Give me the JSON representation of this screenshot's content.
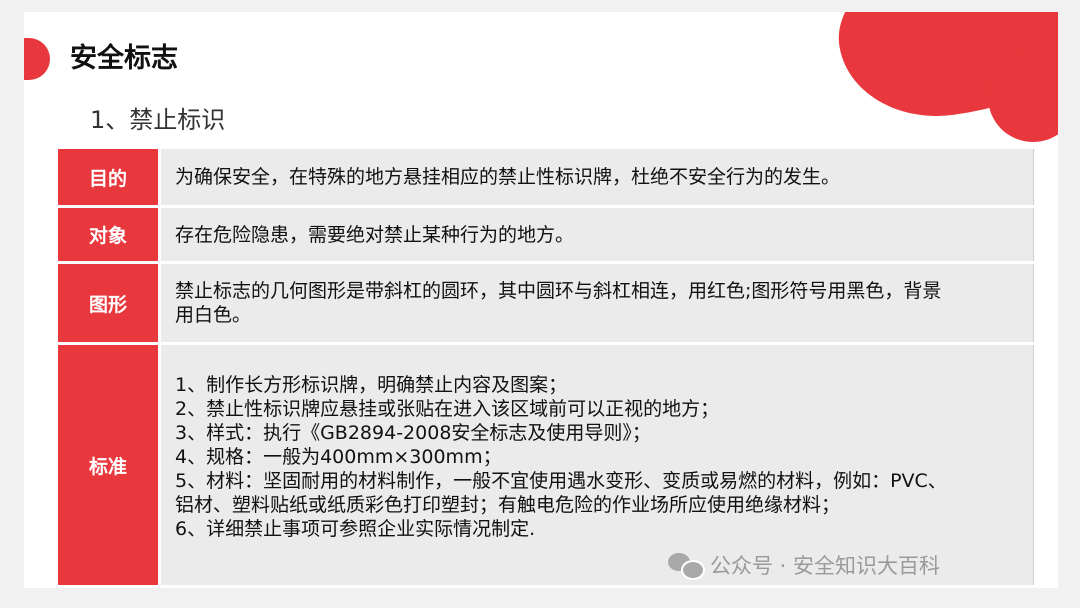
{
  "page": {
    "title": "安全标志",
    "subtitle": "1、禁止标识"
  },
  "table": {
    "rows": [
      {
        "label": "目的",
        "lines": [
          "为确保安全，在特殊的地方悬挂相应的禁止性标识牌，杜绝不安全行为的发生。"
        ]
      },
      {
        "label": "对象",
        "lines": [
          "存在危险隐患，需要绝对禁止某种行为的地方。"
        ]
      },
      {
        "label": "图形",
        "lines": [
          "禁止标志的几何图形是带斜杠的圆环，其中圆环与斜杠相连，用红色;图形符号用黑色，背景",
          "用白色。"
        ]
      },
      {
        "label": "标准",
        "lines": [
          "1、制作长方形标识牌，明确禁止内容及图案；",
          "2、禁止性标识牌应悬挂或张贴在进入该区域前可以正视的地方；",
          "3、样式：执行《GB2894-2008安全标志及使用导则》；",
          "4、规格：一般为400mm×300mm；",
          "5、材料：坚固耐用的材料制作，一般不宜使用遇水变形、变质或易燃的材料，例如：PVC、",
          "铝材、塑料贴纸或纸质彩色打印塑封；有触电危险的作业场所应使用绝缘材料；",
          "6、详细禁止事项可参照企业实际情况制定."
        ]
      }
    ]
  },
  "watermark": {
    "icon": "wechat-icon",
    "text": "公众号 · 安全知识大百科"
  },
  "colors": {
    "accent": "#e8383d",
    "cell_bg": "#ebebeb"
  }
}
